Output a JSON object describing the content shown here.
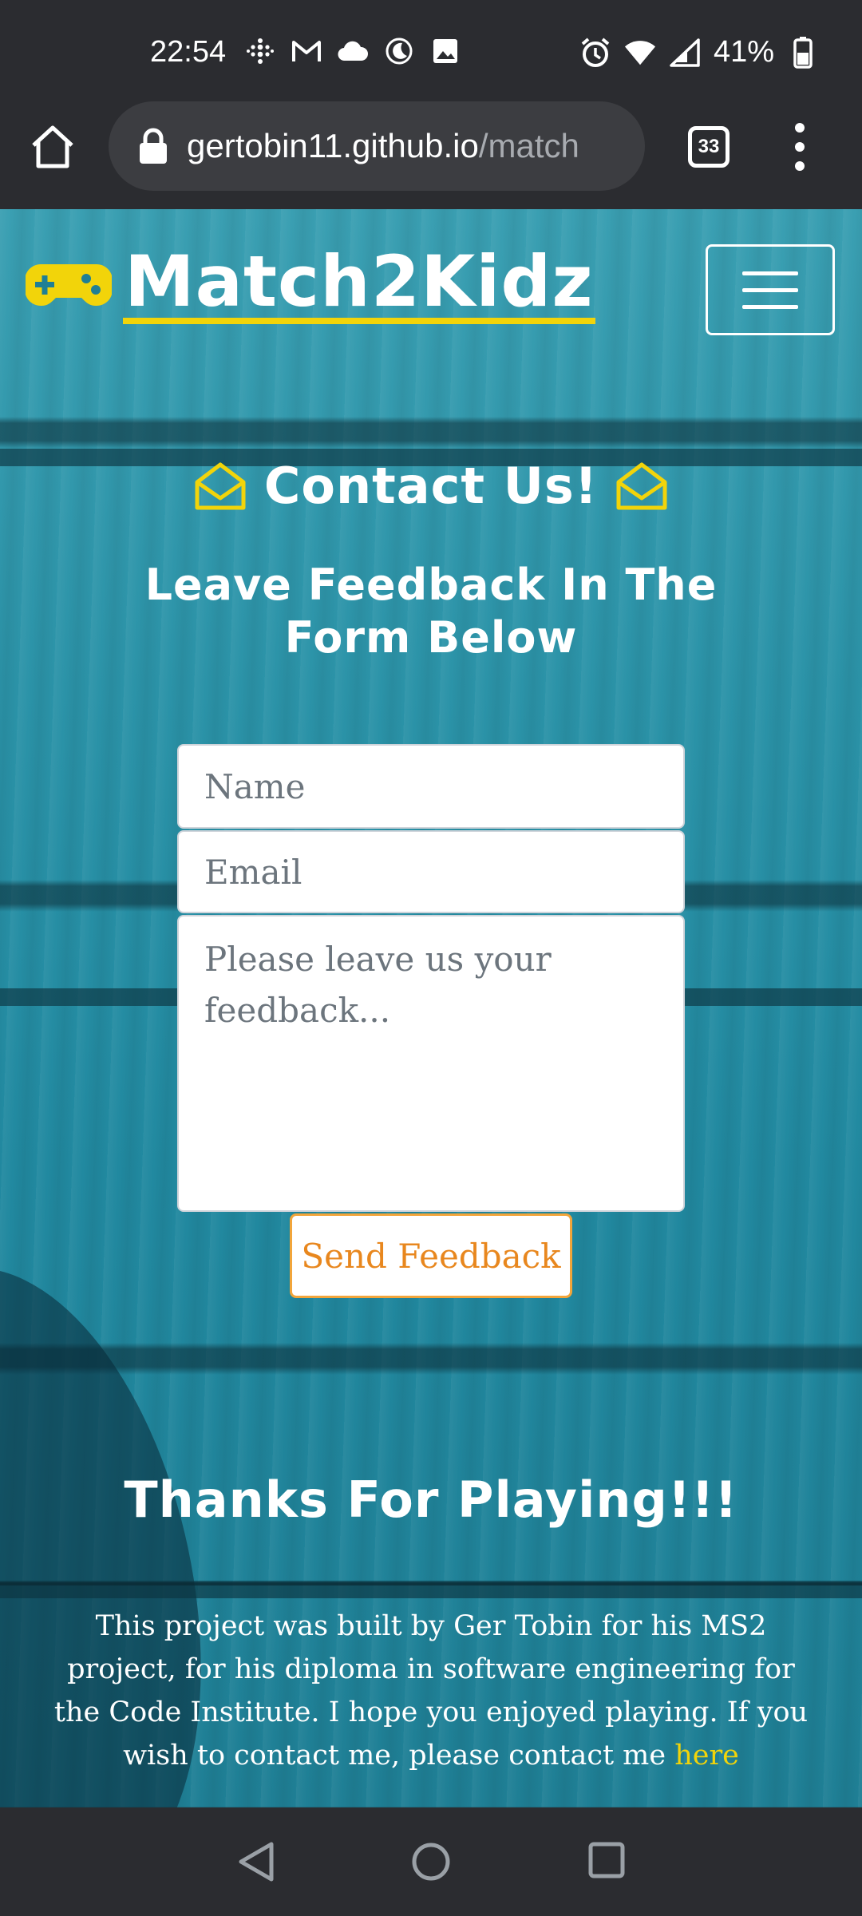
{
  "status_bar": {
    "time": "22:54",
    "battery": "41%",
    "icons_left": [
      "fitbit-icon",
      "gmail-icon",
      "cloud-icon",
      "moon-icon",
      "image-icon"
    ],
    "icons_right": [
      "alarm-icon",
      "wifi-icon",
      "signal-icon",
      "battery-icon"
    ]
  },
  "browser": {
    "url_host": "gertobin11.github.io",
    "url_path": "/match",
    "tab_count": "33"
  },
  "site": {
    "brand": "Match2Kidz",
    "colors": {
      "accent": "#f2d40a",
      "button_text": "#e8871e",
      "button_border": "#f2a53a"
    }
  },
  "contact": {
    "title": "Contact Us!",
    "subtitle": "Leave Feedback In The Form Below",
    "name_placeholder": "Name",
    "email_placeholder": "Email",
    "feedback_placeholder": "Please leave us your feedback...",
    "send_label": "Send Feedback"
  },
  "thanks": "Thanks For Playing!!!",
  "footer": {
    "text": "This project was built by Ger Tobin for his MS2 project, for his diploma in software engineering for the Code Institute. I hope you enjoyed playing. If you wish to contact me, please contact me ",
    "link_label": "here"
  }
}
